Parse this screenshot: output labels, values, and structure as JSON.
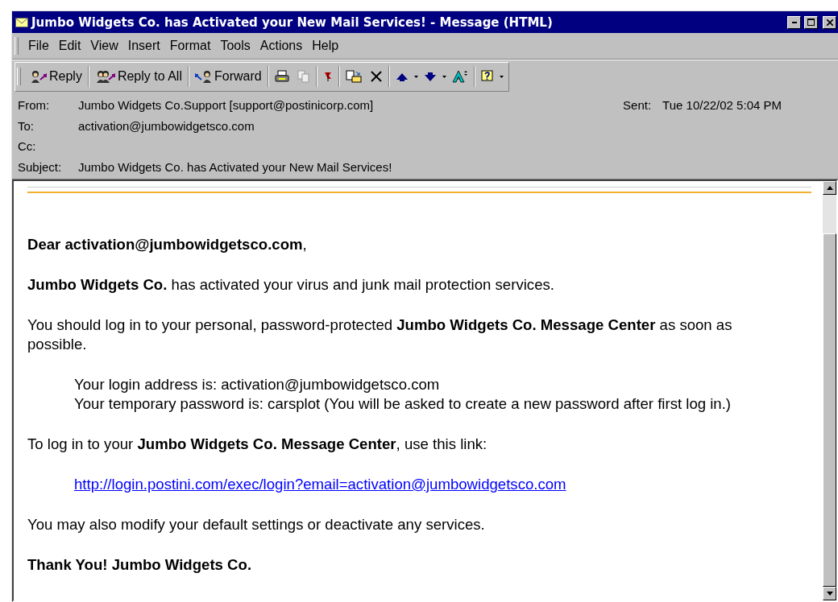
{
  "window": {
    "title": "Jumbo Widgets Co. has Activated your New Mail Services! - Message (HTML)"
  },
  "menu": [
    "File",
    "Edit",
    "View",
    "Insert",
    "Format",
    "Tools",
    "Actions",
    "Help"
  ],
  "toolbar": [
    "Reply",
    "Reply to All",
    "Forward"
  ],
  "header": [
    {
      "label": "From:",
      "value": "Jumbo Widgets Co.Support [support@postinicorp.com]"
    },
    {
      "label": "To:",
      "value": "activation@jumbowidgetsco.com"
    },
    {
      "label": "Cc:"
    },
    {
      "label": "Subject:",
      "value": "Jumbo Widgets Co. has Activated your New Mail Services!"
    }
  ],
  "sent": {
    "label": "Sent:",
    "value": "Tue 10/22/02 5:04 PM"
  },
  "message": [
    {
      "kind": "para",
      "text": "**Dear activation@jumbowidgetsco.com**,"
    },
    {
      "kind": "para",
      "text": "**Jumbo Widgets Co.** has activated your virus and junk mail protection services."
    },
    {
      "kind": "para",
      "text": "You should log in to your personal, password-protected **Jumbo Widgets Co. Message Center** as soon as possible."
    },
    {
      "kind": "indent",
      "lines": [
        "Your login address is: activation@jumbowidgetsco.com",
        "Your temporary password is: carsplot (You will be asked to create a new password after first log in.)"
      ]
    },
    {
      "kind": "para",
      "text": "To log in to your **Jumbo Widgets Co. Message Center**, use this link:"
    },
    {
      "kind": "link",
      "text": "http://login.postini.com/exec/login?email=activation@jumbowidgetsco.com"
    },
    {
      "kind": "para",
      "text": "You may also modify your default settings or deactivate any services."
    },
    {
      "kind": "para",
      "text": "**Thank You! Jumbo Widgets Co.**"
    }
  ]
}
